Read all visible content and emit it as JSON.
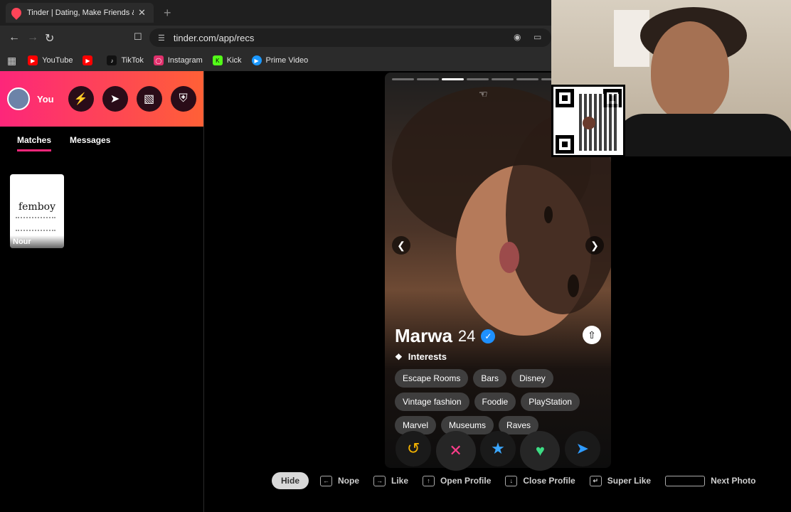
{
  "browser": {
    "tab_title": "Tinder | Dating, Make Friends &",
    "url": "tinder.com/app/recs",
    "bookmarks": [
      {
        "label": "YouTube",
        "icon": "youtube-icon",
        "color": "#ff0000"
      },
      {
        "label": "",
        "icon": "youtube-alt-icon",
        "color": "#ff0000"
      },
      {
        "label": "TikTok",
        "icon": "tiktok-icon",
        "color": "#111111"
      },
      {
        "label": "Instagram",
        "icon": "instagram-icon",
        "color": "#e1306c"
      },
      {
        "label": "Kick",
        "icon": "kick-icon",
        "color": "#53fc18"
      },
      {
        "label": "Prime Video",
        "icon": "prime-video-icon",
        "color": "#1a98ff"
      }
    ]
  },
  "sidebar": {
    "you_label": "You",
    "tabs": [
      "Matches",
      "Messages"
    ],
    "match": {
      "name": "Nour",
      "card_word": "femboy"
    }
  },
  "profile": {
    "name": "Marwa",
    "age": "24",
    "interests_label": "Interests",
    "interests": [
      "Escape Rooms",
      "Bars",
      "Disney",
      "Vintage fashion",
      "Foodie",
      "PlayStation",
      "Marvel",
      "Museums",
      "Raves"
    ],
    "photo_count": 7,
    "active_photo": 3
  },
  "hints": {
    "hide": "Hide",
    "nope": "Nope",
    "like": "Like",
    "open_profile": "Open Profile",
    "close_profile": "Close Profile",
    "super_like": "Super Like",
    "next_photo": "Next Photo"
  },
  "colors": {
    "brand_gradient_start": "#fd267a",
    "brand_gradient_end": "#ff6036"
  }
}
